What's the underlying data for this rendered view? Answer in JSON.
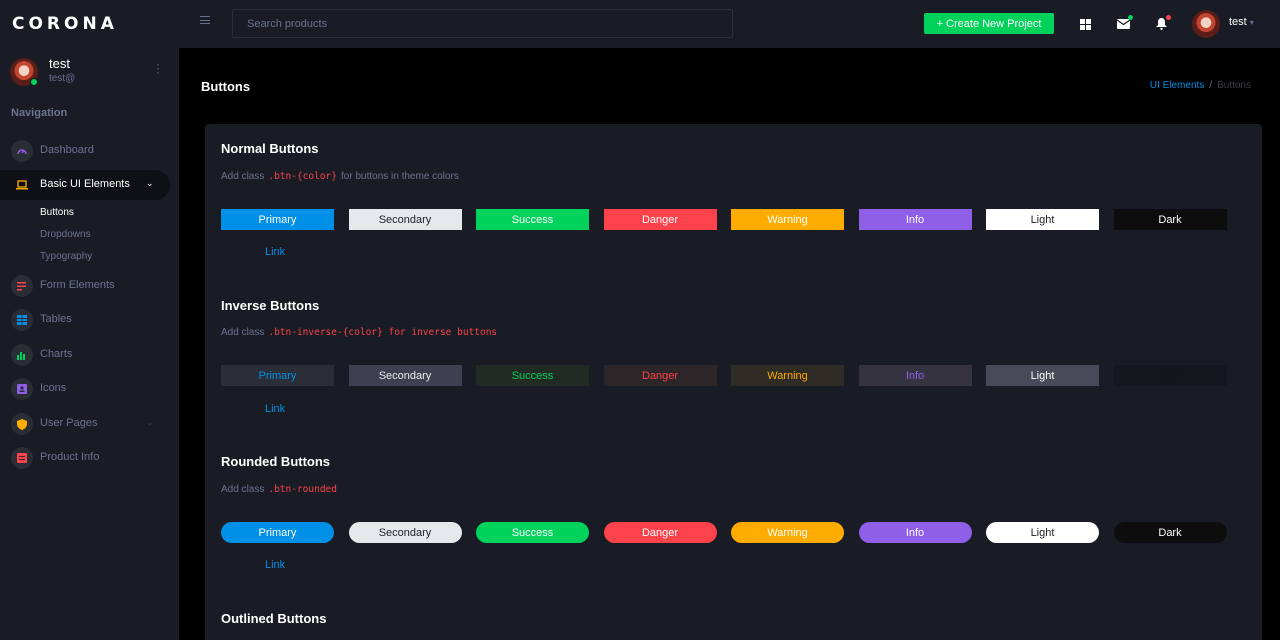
{
  "brand": "CORONA",
  "profile": {
    "name": "test",
    "handle": "test@"
  },
  "nav": {
    "heading": "Navigation",
    "items": [
      {
        "label": "Dashboard",
        "icon": "speedometer-icon",
        "color": "#8f5fe8"
      },
      {
        "label": "Basic UI Elements",
        "icon": "laptop-icon",
        "color": "#ffab00"
      },
      {
        "label": "Form Elements",
        "icon": "playlist-icon",
        "color": "#fc424a"
      },
      {
        "label": "Tables",
        "icon": "table-icon",
        "color": "#0090e7"
      },
      {
        "label": "Charts",
        "icon": "chart-bar-icon",
        "color": "#00d25b"
      },
      {
        "label": "Icons",
        "icon": "contacts-icon",
        "color": "#8f5fe8"
      },
      {
        "label": "User Pages",
        "icon": "security-icon",
        "color": "#ffab00"
      },
      {
        "label": "Product Info",
        "icon": "file-document-icon",
        "color": "#fc424a"
      }
    ],
    "sub_items": [
      "Buttons",
      "Dropdowns",
      "Typography"
    ]
  },
  "topbar": {
    "search_placeholder": "Search products",
    "create_button": "+ Create New Project",
    "user_name": "test"
  },
  "page": {
    "title": "Buttons",
    "breadcrumb": {
      "parent": "UI Elements",
      "separator": "/",
      "current": "Buttons"
    }
  },
  "sections": [
    {
      "title": "Normal Buttons",
      "desc_prefix": "Add class",
      "desc_code": ".btn-{color}",
      "desc_suffix": "for buttons in theme colors"
    },
    {
      "title": "Inverse Buttons",
      "desc_prefix": "Add class",
      "desc_code": ".btn-inverse-{color} for inverse buttons",
      "desc_suffix": ""
    },
    {
      "title": "Rounded Buttons",
      "desc_prefix": "Add class",
      "desc_code": ".btn-rounded",
      "desc_suffix": ""
    },
    {
      "title": "Outlined Buttons"
    }
  ],
  "buttons": [
    {
      "label": "Primary",
      "color": "#0090e7",
      "text": "#ffffff",
      "inv_bg": "#2b2e36",
      "inv_text": "#0090e7"
    },
    {
      "label": "Secondary",
      "color": "#e4eaec",
      "text": "#1d1f26",
      "inv_bg": "#3d4050",
      "inv_text": "#e4eaec"
    },
    {
      "label": "Success",
      "color": "#00d25b",
      "text": "#ffffff",
      "inv_bg": "#222a24",
      "inv_text": "#00d25b"
    },
    {
      "label": "Danger",
      "color": "#fc424a",
      "text": "#ffffff",
      "inv_bg": "#2d2628",
      "inv_text": "#fc424a"
    },
    {
      "label": "Warning",
      "color": "#ffab00",
      "text": "#ffffff",
      "inv_bg": "#2f2b25",
      "inv_text": "#ffab00"
    },
    {
      "label": "Info",
      "color": "#8f5fe8",
      "text": "#ffffff",
      "inv_bg": "#34333f",
      "inv_text": "#8f5fe8"
    },
    {
      "label": "Light",
      "color": "#ffffff",
      "text": "#1d1f26",
      "inv_bg": "#474a58",
      "inv_text": "#ffffff"
    },
    {
      "label": "Dark",
      "color": "#0d0d0d",
      "text": "#ffffff",
      "inv_bg": "#15171e",
      "inv_text": "#15171e"
    }
  ],
  "link_label": "Link"
}
